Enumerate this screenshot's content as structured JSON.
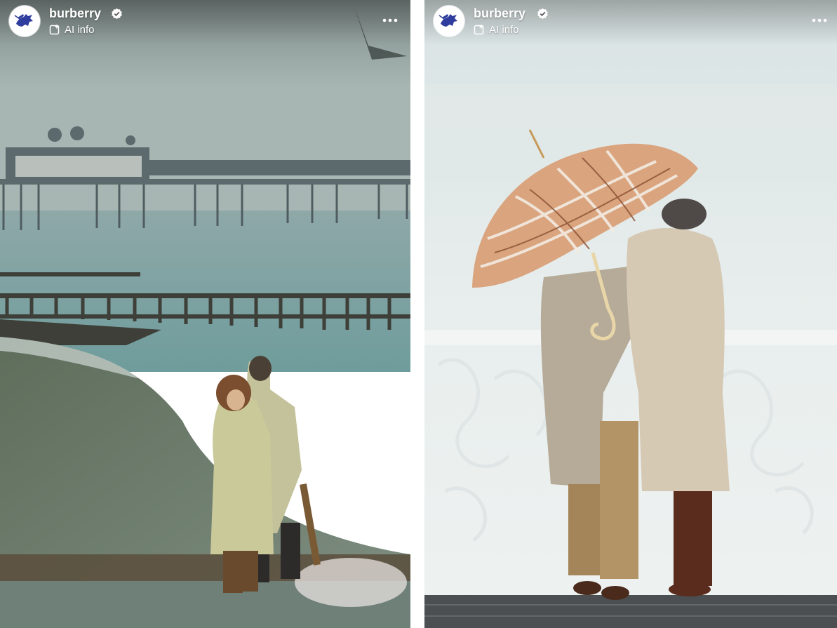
{
  "posts": [
    {
      "account": {
        "name": "burberry",
        "verified": true,
        "ai_info_label": "AI info"
      },
      "more_icon": "more-horizontal-icon"
    },
    {
      "account": {
        "name": "burberry",
        "verified": true,
        "ai_info_label": "AI info"
      },
      "more_icon": "more-horizontal-icon"
    }
  ],
  "colors": {
    "brand_knight_blue": "#2f3e9e",
    "header_text": "#ffffff",
    "divider": "#ffffff"
  }
}
